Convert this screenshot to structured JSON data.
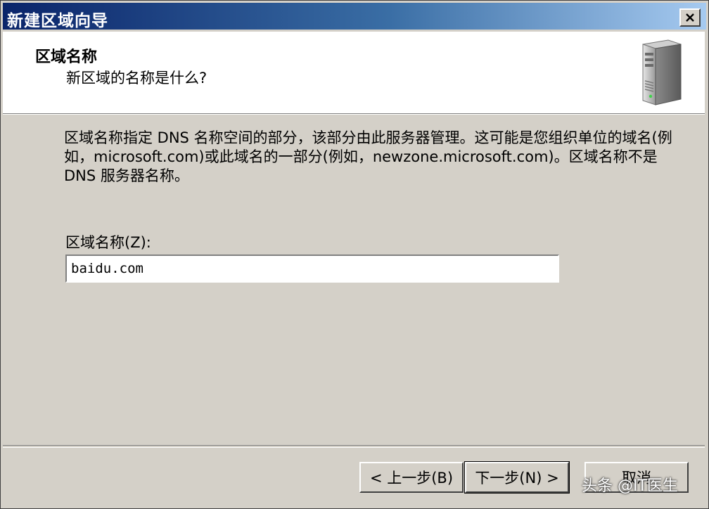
{
  "window": {
    "title": "新建区域向导",
    "close_label": "X"
  },
  "header": {
    "title": "区域名称",
    "subtitle": "新区域的名称是什么?",
    "icon": "server-icon"
  },
  "main": {
    "description": "区域名称指定 DNS 名称空间的部分，该部分由此服务器管理。这可能是您组织单位的域名(例如，microsoft.com)或此域名的一部分(例如，newzone.microsoft.com)。区域名称不是 DNS 服务器名称。",
    "zone_field": {
      "label": "区域名称(Z):",
      "value": "baidu.com"
    }
  },
  "buttons": {
    "back": "< 上一步(B)",
    "next": "下一步(N) >",
    "cancel": "取消"
  },
  "watermark": "头条 @IT医生",
  "colors": {
    "title_gradient_start": "#0a246a",
    "title_gradient_end": "#a6caf0",
    "dialog_bg": "#d4d0c8",
    "header_bg": "#ffffff"
  }
}
